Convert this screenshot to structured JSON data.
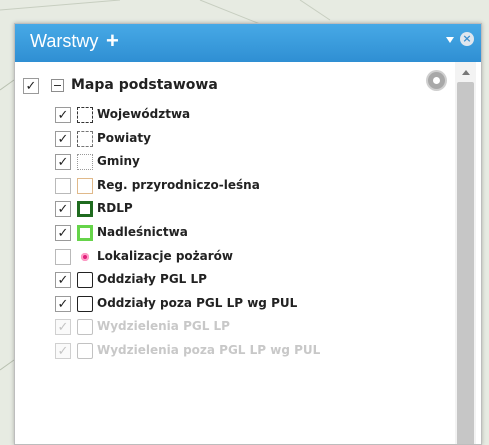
{
  "panel": {
    "title": "Warstwy",
    "add_glyph": "+",
    "close_glyph": "×"
  },
  "group": {
    "label": "Mapa podstawowa",
    "checked": true,
    "checkmark": "✓"
  },
  "layers": [
    {
      "label": "Województwa",
      "checked": true,
      "symbol": "dashed-dark",
      "enabled": true,
      "mark": "✓"
    },
    {
      "label": "Powiaty",
      "checked": true,
      "symbol": "dashed-mid",
      "enabled": true,
      "mark": "✓"
    },
    {
      "label": "Gminy",
      "checked": true,
      "symbol": "dotted-light",
      "enabled": true,
      "mark": "✓"
    },
    {
      "label": "Reg. przyrodniczo-leśna",
      "checked": false,
      "symbol": "orange-outline",
      "enabled": true,
      "mark": ""
    },
    {
      "label": "RDLP",
      "checked": true,
      "symbol": "dark-green-thick",
      "enabled": true,
      "mark": "✓"
    },
    {
      "label": "Nadleśnictwa",
      "checked": true,
      "symbol": "light-green",
      "enabled": true,
      "mark": "✓"
    },
    {
      "label": "Lokalizacje pożarów",
      "checked": false,
      "symbol": "pink-dot",
      "enabled": true,
      "mark": ""
    },
    {
      "label": "Oddziały PGL LP",
      "checked": true,
      "symbol": "black-outline",
      "enabled": true,
      "mark": "✓"
    },
    {
      "label": "Oddziały poza PGL LP wg PUL",
      "checked": true,
      "symbol": "black-outline",
      "enabled": true,
      "mark": "✓"
    },
    {
      "label": "Wydzielenia PGL LP",
      "checked": true,
      "symbol": "grey-outline",
      "enabled": false,
      "mark": "✓"
    },
    {
      "label": "Wydzielenia poza PGL LP wg PUL",
      "checked": true,
      "symbol": "grey-outline",
      "enabled": false,
      "mark": "✓"
    }
  ],
  "colors": {
    "header": "#3a9ddd",
    "rdlp": "#1f6b1f",
    "nadlesnictwa": "#66d44a",
    "reg": "#e0b98a",
    "pozary": "#e0207a"
  }
}
